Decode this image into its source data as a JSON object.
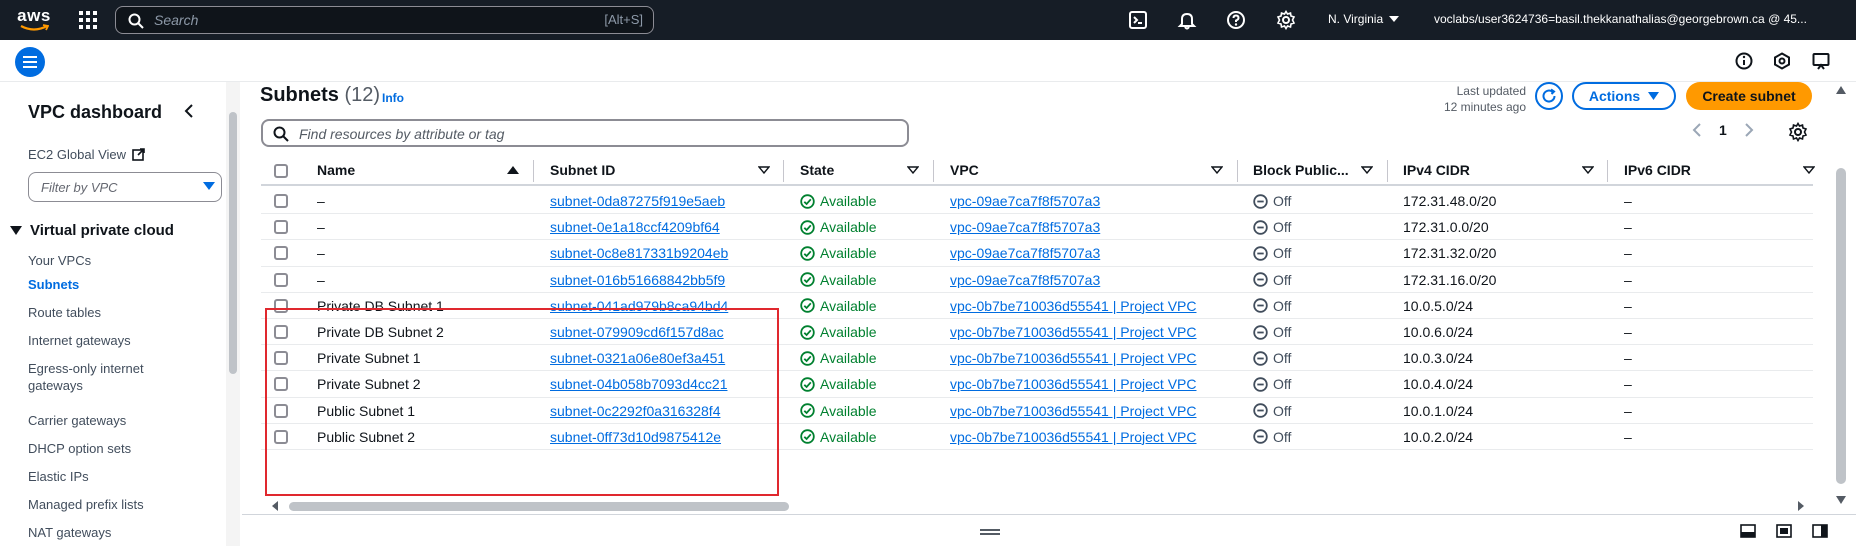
{
  "topbar": {
    "logo_text": "aws",
    "search_placeholder": "Search",
    "search_shortcut": "[Alt+S]",
    "region": "N. Virginia",
    "account": "voclabs/user3624736=basil.thekkanathalias@georgebrown.ca @ 45..."
  },
  "sidebar": {
    "title": "VPC dashboard",
    "ec2_link": "EC2 Global View",
    "filter_placeholder": "Filter by VPC",
    "section": "Virtual private cloud",
    "items": [
      {
        "label": "Your VPCs"
      },
      {
        "label": "Subnets"
      },
      {
        "label": "Route tables"
      },
      {
        "label": "Internet gateways"
      },
      {
        "label": "Egress-only internet gateways"
      },
      {
        "label": "Carrier gateways"
      },
      {
        "label": "DHCP option sets"
      },
      {
        "label": "Elastic IPs"
      },
      {
        "label": "Managed prefix lists"
      },
      {
        "label": "NAT gateways"
      }
    ]
  },
  "main": {
    "title": "Subnets",
    "count": "(12)",
    "info": "Info",
    "last_updated_1": "Last updated",
    "last_updated_2": "12 minutes ago",
    "actions_label": "Actions",
    "create_label": "Create subnet",
    "find_placeholder": "Find resources by attribute or tag",
    "page_number": "1"
  },
  "table": {
    "headers": [
      "Name",
      "Subnet ID",
      "State",
      "VPC",
      "Block Public...",
      "IPv4 CIDR",
      "IPv6 CIDR"
    ],
    "rows": [
      {
        "name": "–",
        "subnet_id": "subnet-0da87275f919e5aeb",
        "state": "Available",
        "vpc": "vpc-09ae7ca7f8f5707a3",
        "block": "Off",
        "ipv4": "172.31.48.0/20",
        "ipv6": "–"
      },
      {
        "name": "–",
        "subnet_id": "subnet-0e1a18ccf4209bf64",
        "state": "Available",
        "vpc": "vpc-09ae7ca7f8f5707a3",
        "block": "Off",
        "ipv4": "172.31.0.0/20",
        "ipv6": "–"
      },
      {
        "name": "–",
        "subnet_id": "subnet-0c8e817331b9204eb",
        "state": "Available",
        "vpc": "vpc-09ae7ca7f8f5707a3",
        "block": "Off",
        "ipv4": "172.31.32.0/20",
        "ipv6": "–"
      },
      {
        "name": "–",
        "subnet_id": "subnet-016b51668842bb5f9",
        "state": "Available",
        "vpc": "vpc-09ae7ca7f8f5707a3",
        "block": "Off",
        "ipv4": "172.31.16.0/20",
        "ipv6": "–"
      },
      {
        "name": "Private DB Subnet 1",
        "subnet_id": "subnet-041ad979b8ca94bd4",
        "state": "Available",
        "vpc": "vpc-0b7be710036d55541 | Project VPC",
        "block": "Off",
        "ipv4": "10.0.5.0/24",
        "ipv6": "–"
      },
      {
        "name": "Private DB Subnet 2",
        "subnet_id": "subnet-079909cd6f157d8ac",
        "state": "Available",
        "vpc": "vpc-0b7be710036d55541 | Project VPC",
        "block": "Off",
        "ipv4": "10.0.6.0/24",
        "ipv6": "–"
      },
      {
        "name": "Private Subnet 1",
        "subnet_id": "subnet-0321a06e80ef3a451",
        "state": "Available",
        "vpc": "vpc-0b7be710036d55541 | Project VPC",
        "block": "Off",
        "ipv4": "10.0.3.0/24",
        "ipv6": "–"
      },
      {
        "name": "Private Subnet 2",
        "subnet_id": "subnet-04b058b7093d4cc21",
        "state": "Available",
        "vpc": "vpc-0b7be710036d55541 | Project VPC",
        "block": "Off",
        "ipv4": "10.0.4.0/24",
        "ipv6": "–"
      },
      {
        "name": "Public Subnet 1",
        "subnet_id": "subnet-0c2292f0a316328f4",
        "state": "Available",
        "vpc": "vpc-0b7be710036d55541 | Project VPC",
        "block": "Off",
        "ipv4": "10.0.1.0/24",
        "ipv6": "–"
      },
      {
        "name": "Public Subnet 2",
        "subnet_id": "subnet-0ff73d10d9875412e",
        "state": "Available",
        "vpc": "vpc-0b7be710036d55541 | Project VPC",
        "block": "Off",
        "ipv4": "10.0.2.0/24",
        "ipv6": "–"
      }
    ]
  },
  "colors": {
    "topbar_bg": "#161d26",
    "link": "#006ce0",
    "available": "#00802f",
    "primary_button": "#ff9900",
    "highlight": "#e0282e"
  },
  "icons": [
    "grid-icon",
    "search-icon",
    "cloudshell-icon",
    "bell-icon",
    "help-icon",
    "settings-icon",
    "hamburger-icon",
    "info-circle-icon",
    "feedback-icon",
    "refresh-icon",
    "caret-down-icon",
    "external-link-icon",
    "chevron-left-icon",
    "chevron-right-icon",
    "check-circle-icon",
    "minus-circle-icon",
    "sort-icon"
  ]
}
